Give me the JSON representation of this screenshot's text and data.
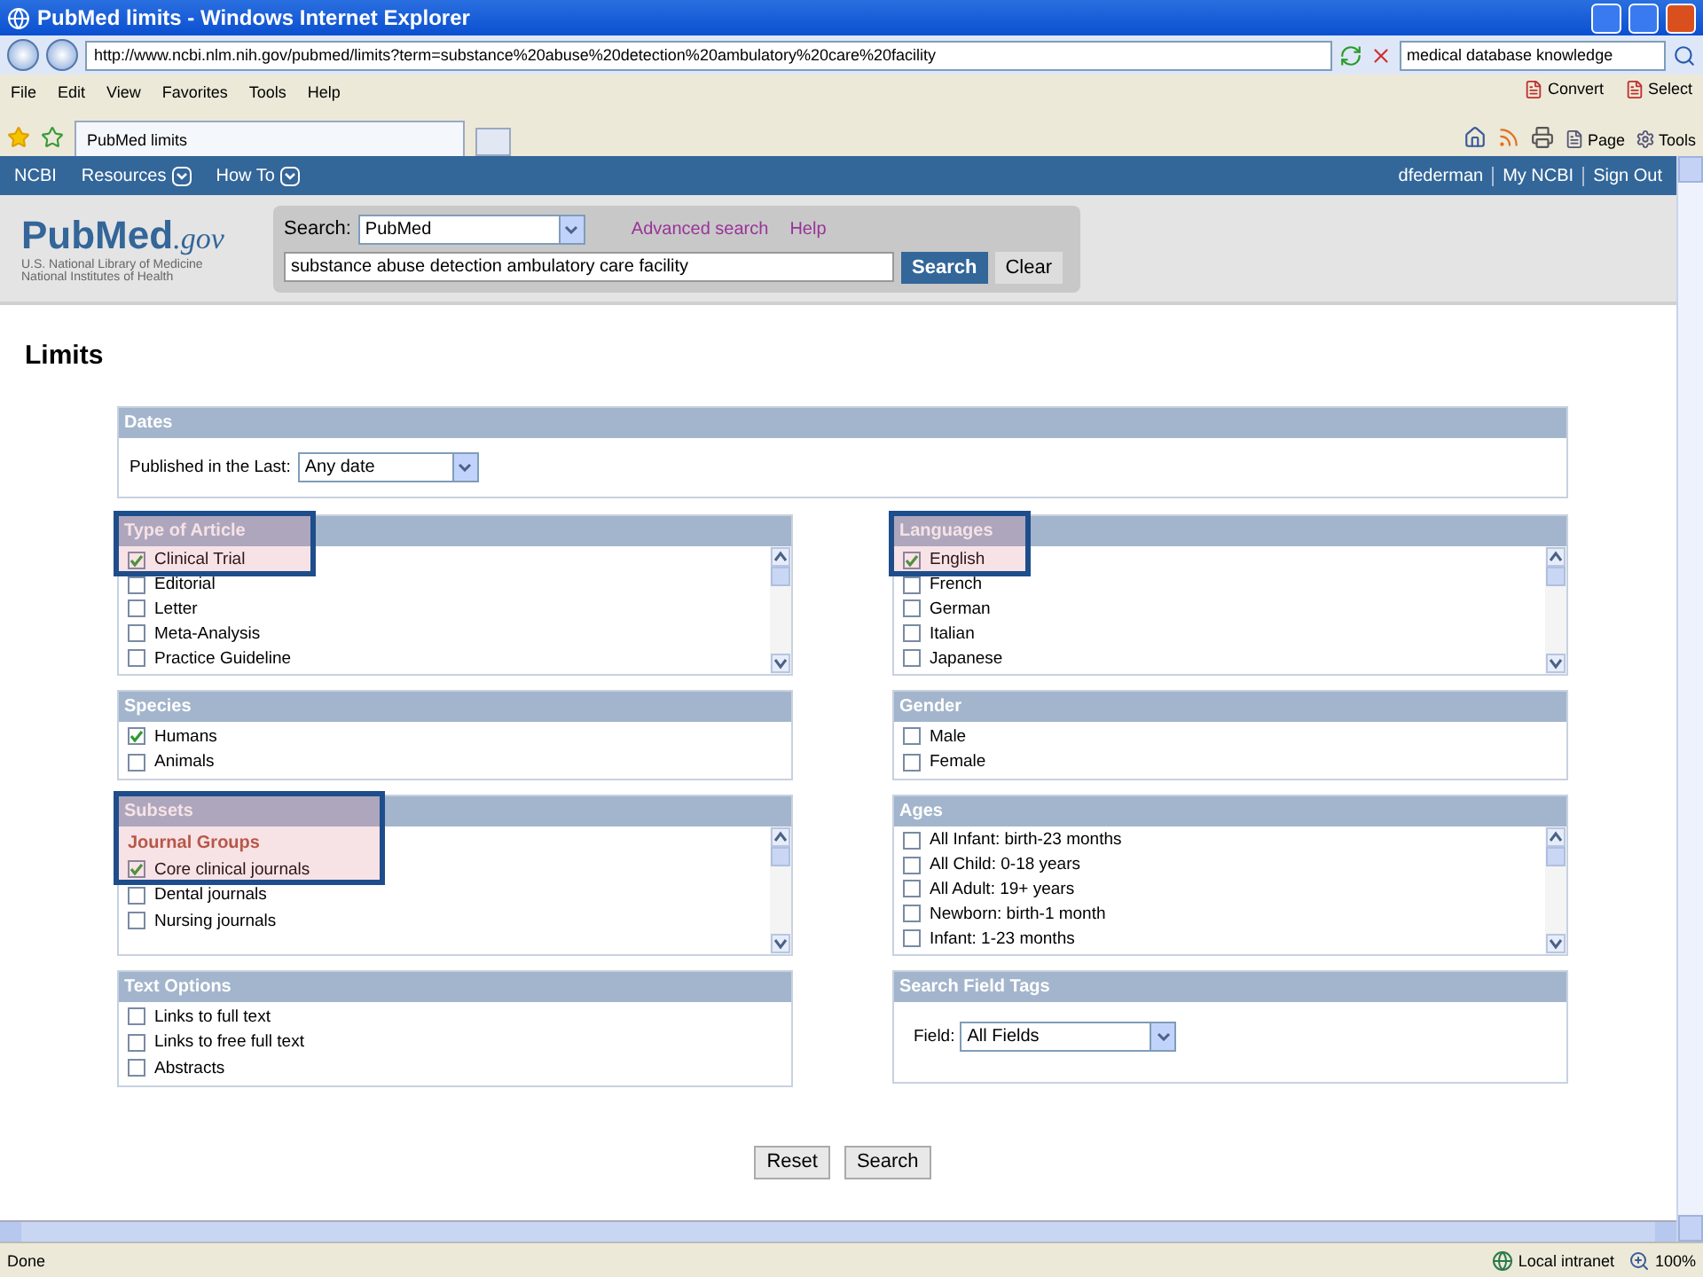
{
  "window": {
    "title": "PubMed limits - Windows Internet Explorer"
  },
  "address_bar": {
    "url": "http://www.ncbi.nlm.nih.gov/pubmed/limits?term=substance%20abuse%20detection%20ambulatory%20care%20facility",
    "search": "medical database knowledge"
  },
  "menu": [
    "File",
    "Edit",
    "View",
    "Favorites",
    "Tools",
    "Help"
  ],
  "menu_tools": [
    "Convert",
    "Select"
  ],
  "tabs": [
    {
      "label": "PubMed limits",
      "selected": true
    }
  ],
  "command_bar": [
    "Page",
    "Tools"
  ],
  "ncbi_bar": {
    "brand": "NCBI",
    "menus": [
      "Resources",
      "How To"
    ],
    "user": "dfederman",
    "links": [
      "My NCBI",
      "Sign Out"
    ]
  },
  "header": {
    "logo": "PubMed",
    "logo_suffix": ".gov",
    "org": [
      "U.S. National Library of Medicine",
      "National Institutes of Health"
    ],
    "search_label": "Search:",
    "database": "PubMed",
    "links": [
      "Advanced search",
      "Help"
    ],
    "query": "substance abuse detection ambulatory care facility",
    "buttons": [
      "Search",
      "Clear"
    ]
  },
  "page_title": "Limits",
  "dates": {
    "title": "Dates",
    "label": "Published in the Last:",
    "value": "Any date"
  },
  "columns": [
    [
      {
        "title": "Type of Article",
        "scroll": true,
        "items": [
          {
            "kind": "check",
            "label": "Clinical Trial",
            "checked": true,
            "highlighted": true
          },
          {
            "kind": "check",
            "label": "Editorial",
            "checked": false,
            "highlighted": false
          },
          {
            "kind": "check",
            "label": "Letter",
            "checked": false,
            "highlighted": false
          },
          {
            "kind": "check",
            "label": "Meta-Analysis",
            "checked": false,
            "highlighted": false
          },
          {
            "kind": "check",
            "label": "Practice Guideline",
            "checked": false,
            "highlighted": false
          }
        ]
      },
      {
        "title": "Species",
        "scroll": false,
        "items": [
          {
            "kind": "check",
            "label": "Humans",
            "checked": true,
            "highlighted": false
          },
          {
            "kind": "check",
            "label": "Animals",
            "checked": false,
            "highlighted": false
          }
        ]
      },
      {
        "title": "Subsets",
        "scroll": true,
        "items": [
          {
            "kind": "group",
            "label": "Journal Groups",
            "highlighted": true
          },
          {
            "kind": "check",
            "label": "Core clinical journals",
            "checked": true,
            "highlighted": true
          },
          {
            "kind": "check",
            "label": "Dental journals",
            "checked": false,
            "highlighted": false
          },
          {
            "kind": "check",
            "label": "Nursing journals",
            "checked": false,
            "highlighted": false
          }
        ]
      },
      {
        "title": "Text Options",
        "scroll": false,
        "items": [
          {
            "kind": "check",
            "label": "Links to full text",
            "checked": false,
            "highlighted": false
          },
          {
            "kind": "check",
            "label": "Links to free full text",
            "checked": false,
            "highlighted": false
          },
          {
            "kind": "check",
            "label": "Abstracts",
            "checked": false,
            "highlighted": false
          }
        ]
      }
    ],
    [
      {
        "title": "Languages",
        "scroll": true,
        "items": [
          {
            "kind": "check",
            "label": "English",
            "checked": true,
            "highlighted": true
          },
          {
            "kind": "check",
            "label": "French",
            "checked": false,
            "highlighted": false
          },
          {
            "kind": "check",
            "label": "German",
            "checked": false,
            "highlighted": false
          },
          {
            "kind": "check",
            "label": "Italian",
            "checked": false,
            "highlighted": false
          },
          {
            "kind": "check",
            "label": "Japanese",
            "checked": false,
            "highlighted": false
          }
        ]
      },
      {
        "title": "Gender",
        "scroll": false,
        "items": [
          {
            "kind": "check",
            "label": "Male",
            "checked": false,
            "highlighted": false
          },
          {
            "kind": "check",
            "label": "Female",
            "checked": false,
            "highlighted": false
          }
        ]
      },
      {
        "title": "Ages",
        "scroll": true,
        "items": [
          {
            "kind": "check",
            "label": "All Infant: birth-23 months",
            "checked": false,
            "highlighted": false
          },
          {
            "kind": "check",
            "label": "All Child: 0-18 years",
            "checked": false,
            "highlighted": false
          },
          {
            "kind": "check",
            "label": "All Adult: 19+ years",
            "checked": false,
            "highlighted": false
          },
          {
            "kind": "check",
            "label": "Newborn: birth-1 month",
            "checked": false,
            "highlighted": false
          },
          {
            "kind": "check",
            "label": "Infant: 1-23 months",
            "checked": false,
            "highlighted": false
          }
        ]
      },
      {
        "title": "Search Field Tags",
        "scroll": false,
        "items": [
          {
            "kind": "select",
            "label": "Field:",
            "value": "All Fields"
          }
        ]
      }
    ]
  ],
  "buttons": [
    "Reset",
    "Search"
  ],
  "status": {
    "text": "Done",
    "zone": "Local intranet",
    "zoom": "100%"
  }
}
